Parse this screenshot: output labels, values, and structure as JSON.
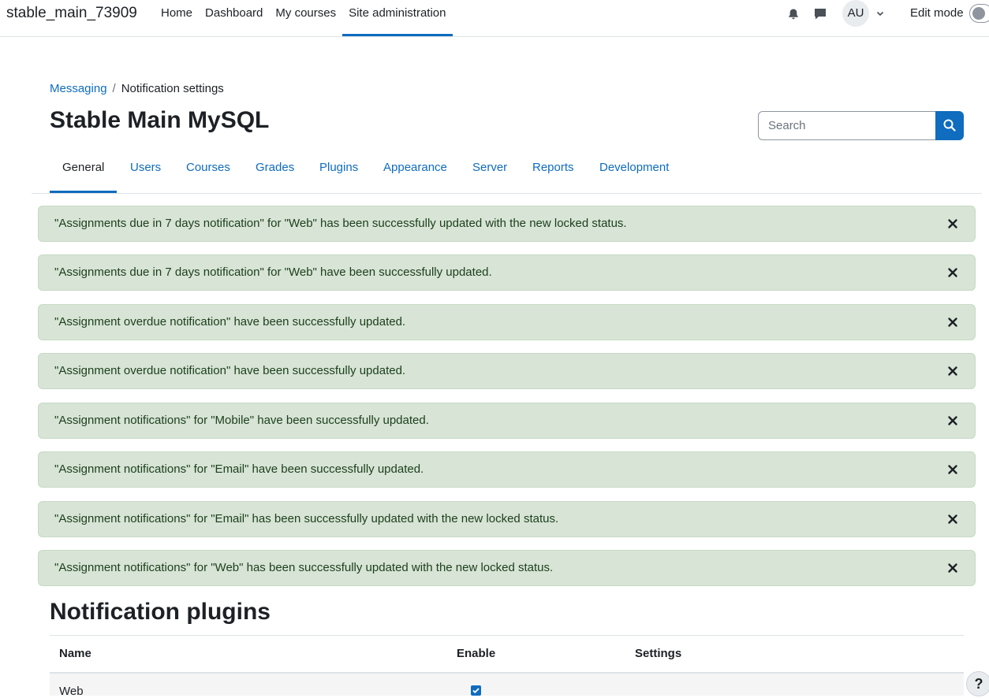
{
  "navbar": {
    "site_name": "stable_main_73909",
    "items": [
      {
        "label": "Home",
        "active": false
      },
      {
        "label": "Dashboard",
        "active": false
      },
      {
        "label": "My courses",
        "active": false
      },
      {
        "label": "Site administration",
        "active": true
      }
    ],
    "avatar_initials": "AU",
    "edit_mode_label": "Edit mode",
    "edit_mode_on": false,
    "icons": [
      "bell-icon",
      "chat-icon",
      "chevron-down-icon"
    ]
  },
  "breadcrumb": {
    "items": [
      "Messaging",
      "Notification settings"
    ],
    "separator": "/"
  },
  "page_title": "Stable Main MySQL",
  "search": {
    "placeholder": "Search"
  },
  "tabs": [
    {
      "label": "General",
      "active": true
    },
    {
      "label": "Users",
      "active": false
    },
    {
      "label": "Courses",
      "active": false
    },
    {
      "label": "Grades",
      "active": false
    },
    {
      "label": "Plugins",
      "active": false
    },
    {
      "label": "Appearance",
      "active": false
    },
    {
      "label": "Server",
      "active": false
    },
    {
      "label": "Reports",
      "active": false
    },
    {
      "label": "Development",
      "active": false
    }
  ],
  "alerts": [
    "\"Assignments due in 7 days notification\" for \"Web\" has been successfully updated with the new locked status.",
    "\"Assignments due in 7 days notification\" for \"Web\" have been successfully updated.",
    "\"Assignment overdue notification\" have been successfully updated.",
    "\"Assignment overdue notification\" have been successfully updated.",
    "\"Assignment notifications\" for \"Mobile\" have been successfully updated.",
    "\"Assignment notifications\" for \"Email\" have been successfully updated.",
    "\"Assignment notifications\" for \"Email\" has been successfully updated with the new locked status.",
    "\"Assignment notifications\" for \"Web\" has been successfully updated with the new locked status."
  ],
  "plugins_section": {
    "title": "Notification plugins",
    "columns": [
      "Name",
      "Enable",
      "Settings"
    ],
    "rows": [
      {
        "name": "Web",
        "enabled": true,
        "settings": ""
      }
    ]
  },
  "help_label": "?",
  "colors": {
    "brand": "#0f6cbf",
    "alert_success_bg": "#d7e4d6",
    "alert_success_text": "#1c3f1a"
  }
}
